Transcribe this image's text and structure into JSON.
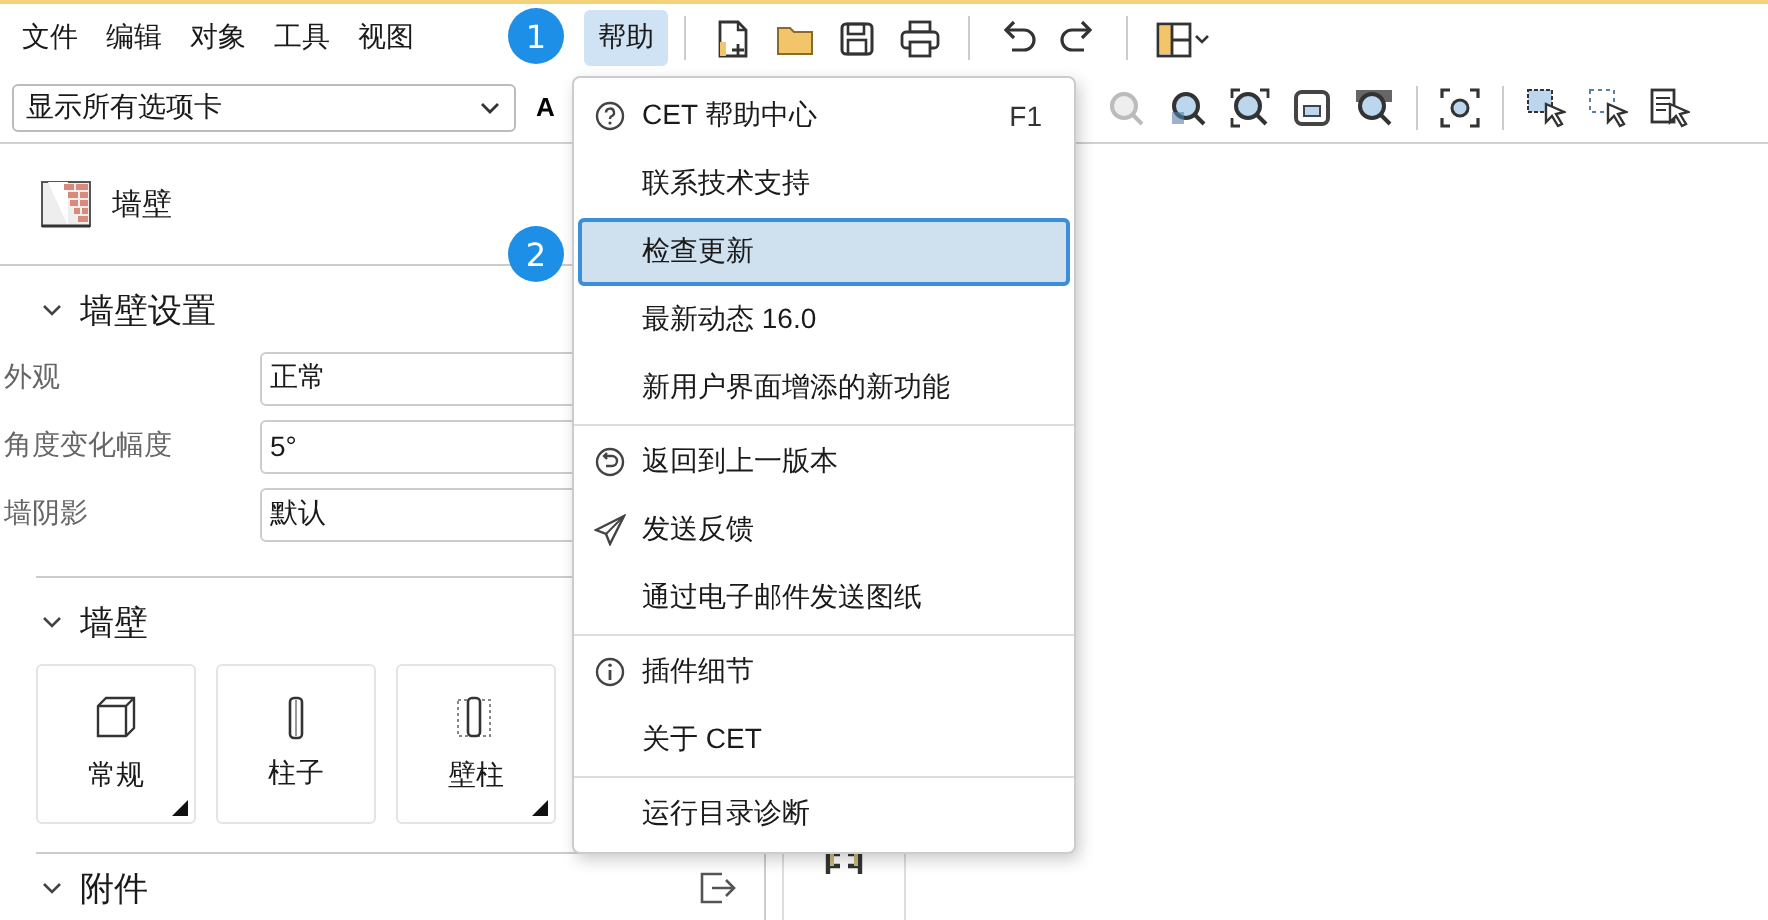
{
  "menubar": {
    "items": [
      {
        "label": "文件",
        "selected": false
      },
      {
        "label": "编辑",
        "selected": false
      },
      {
        "label": "对象",
        "selected": false
      },
      {
        "label": "工具",
        "selected": false
      },
      {
        "label": "视图",
        "selected": false
      },
      {
        "label": "帮助",
        "selected": true
      }
    ]
  },
  "toolbar": {
    "tab_filter": {
      "value": "显示所有选项卡"
    },
    "font_button": "A"
  },
  "panel": {
    "title": "墙壁",
    "sections": [
      {
        "title": "墙壁设置",
        "kind": "properties",
        "expanded": true,
        "rows": [
          {
            "label": "外观",
            "value": "正常"
          },
          {
            "label": "角度变化幅度",
            "value": "5°"
          },
          {
            "label": "墙阴影",
            "value": "默认"
          }
        ]
      },
      {
        "title": "墙壁",
        "kind": "tiles",
        "expanded": true,
        "tiles": [
          {
            "label": "常规",
            "has_submenu": true
          },
          {
            "label": "柱子",
            "has_submenu": false
          },
          {
            "label": "壁柱",
            "has_submenu": true
          }
        ]
      },
      {
        "title": "附件",
        "kind": "header",
        "expanded": true
      }
    ]
  },
  "help_menu": {
    "items": [
      {
        "label": "CET 帮助中心",
        "shortcut": "F1",
        "highlighted": false,
        "separator_before": false
      },
      {
        "label": "联系技术支持",
        "highlighted": false,
        "separator_before": false
      },
      {
        "label": "检查更新",
        "highlighted": true,
        "separator_before": false
      },
      {
        "label": "最新动态 16.0",
        "highlighted": false,
        "separator_before": false
      },
      {
        "label": "新用户界面增添的新功能",
        "highlighted": false,
        "separator_before": false
      },
      {
        "label": "返回到上一版本",
        "highlighted": false,
        "separator_before": true
      },
      {
        "label": "发送反馈",
        "highlighted": false,
        "separator_before": false
      },
      {
        "label": "通过电子邮件发送图纸",
        "highlighted": false,
        "separator_before": false
      },
      {
        "label": "插件细节",
        "highlighted": false,
        "separator_before": true
      },
      {
        "label": "关于 CET",
        "highlighted": false,
        "separator_before": false
      },
      {
        "label": "运行目录诊断",
        "highlighted": false,
        "separator_before": true
      }
    ]
  },
  "annotations": [
    {
      "label": "1"
    },
    {
      "label": "2"
    }
  ]
}
